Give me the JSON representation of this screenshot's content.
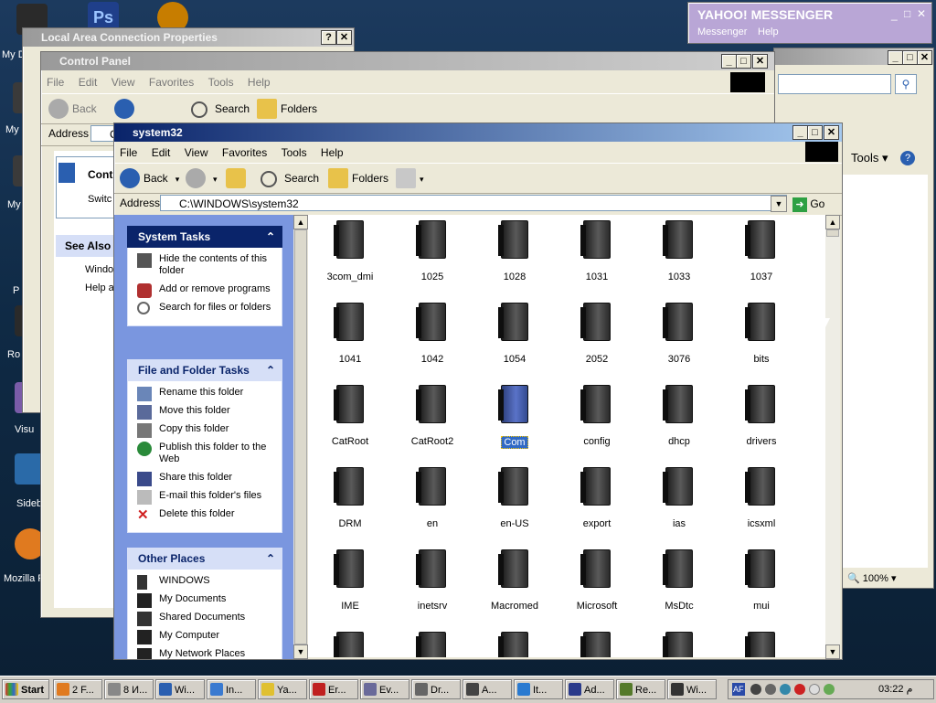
{
  "desktop": {
    "labels": [
      "My D",
      "My",
      "My",
      "P",
      "Ro",
      "Visu",
      "Sideb",
      "Mozilla Fi"
    ]
  },
  "yahoo": {
    "title": "YAHOO! MESSENGER",
    "menu": [
      "Messenger",
      "Help"
    ]
  },
  "lac": {
    "title": "Local Area Connection Properties",
    "help": "?",
    "close": "✕"
  },
  "control_panel": {
    "title": "Control Panel",
    "menu": [
      "File",
      "Edit",
      "View",
      "Favorites",
      "Tools",
      "Help"
    ],
    "back": "Back",
    "search": "Search",
    "folders": "Folders",
    "address_label": "Address",
    "address_value": "C",
    "side_title": "Contr",
    "side_switch": "Switc",
    "see_also": "See Also",
    "see_windows": "Windo",
    "see_help": "Help a"
  },
  "ie": {
    "tools": "Tools",
    "zoom": "100%"
  },
  "system32": {
    "title": "system32",
    "menu": [
      "File",
      "Edit",
      "View",
      "Favorites",
      "Tools",
      "Help"
    ],
    "back": "Back",
    "search": "Search",
    "folders": "Folders",
    "address_label": "Address",
    "address_value": "C:\\WINDOWS\\system32",
    "go": "Go",
    "system_tasks": {
      "title": "System Tasks",
      "items": [
        "Hide the contents of this folder",
        "Add or remove programs",
        "Search for files or folders"
      ]
    },
    "file_tasks": {
      "title": "File and Folder Tasks",
      "items": [
        "Rename this folder",
        "Move this folder",
        "Copy this folder",
        "Publish this folder to the Web",
        "Share this folder",
        "E-mail this folder's files",
        "Delete this folder"
      ]
    },
    "other_places": {
      "title": "Other Places",
      "items": [
        "WINDOWS",
        "My Documents",
        "Shared Documents",
        "My Computer",
        "My Network Places"
      ]
    },
    "folders_list": [
      "3com_dmi",
      "1025",
      "1028",
      "1031",
      "1033",
      "1037",
      "1041",
      "1042",
      "1054",
      "2052",
      "3076",
      "bits",
      "CatRoot",
      "CatRoot2",
      "Com",
      "config",
      "dhcp",
      "drivers",
      "DRM",
      "en",
      "en-US",
      "export",
      "ias",
      "icsxml",
      "IME",
      "inetsrv",
      "Macromed",
      "Microsoft",
      "MsDtc",
      "mui"
    ],
    "selected_folder": "Com"
  },
  "taskbar": {
    "start": "Start",
    "items": [
      "2 F...",
      "8 И...",
      "Wi...",
      "In...",
      "Ya...",
      "Er...",
      "Ev...",
      "Dr...",
      "A...",
      "It...",
      "Ad...",
      "Re...",
      "Wi..."
    ],
    "lang": "AF",
    "clock": "03:22 م"
  }
}
